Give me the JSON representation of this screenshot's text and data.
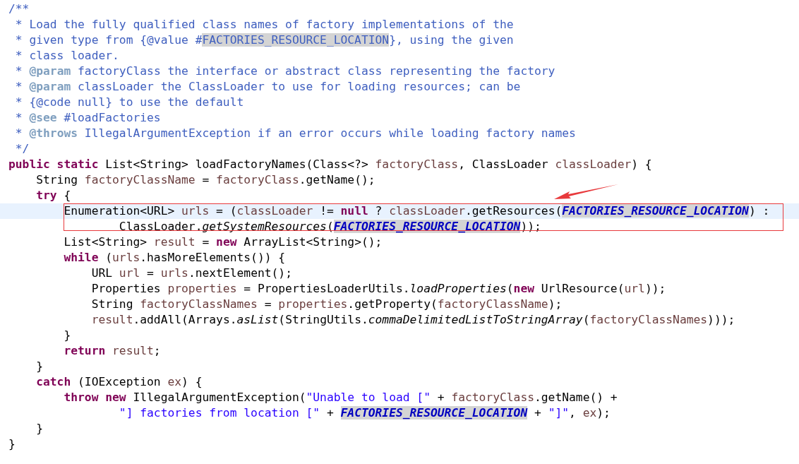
{
  "editor": {
    "lines": [
      {
        "current": false,
        "tokens": [
          {
            "text": "/**",
            "kind": "comment",
            "marked": false
          }
        ]
      },
      {
        "current": false,
        "tokens": [
          {
            "text": " * Load the fully qualified class names of factory implementations of the",
            "kind": "comment",
            "marked": false
          }
        ]
      },
      {
        "current": false,
        "tokens": [
          {
            "text": " * given type from {@value #",
            "kind": "comment",
            "marked": false
          },
          {
            "text": "FACTORIES_RESOURCE_LOCATION",
            "kind": "comment",
            "marked": true
          },
          {
            "text": "}, using the given",
            "kind": "comment",
            "marked": false
          }
        ]
      },
      {
        "current": false,
        "tokens": [
          {
            "text": " * class loader.",
            "kind": "comment",
            "marked": false
          }
        ]
      },
      {
        "current": false,
        "tokens": [
          {
            "text": " * ",
            "kind": "comment",
            "marked": false
          },
          {
            "text": "@param",
            "kind": "tag",
            "marked": false
          },
          {
            "text": " factoryClass the interface or abstract class representing the factory",
            "kind": "comment",
            "marked": false
          }
        ]
      },
      {
        "current": false,
        "tokens": [
          {
            "text": " * ",
            "kind": "comment",
            "marked": false
          },
          {
            "text": "@param",
            "kind": "tag",
            "marked": false
          },
          {
            "text": " classLoader the ClassLoader to use for loading resources; can be",
            "kind": "comment",
            "marked": false
          }
        ]
      },
      {
        "current": false,
        "tokens": [
          {
            "text": " * {@code null} to use the default",
            "kind": "comment",
            "marked": false
          }
        ]
      },
      {
        "current": false,
        "tokens": [
          {
            "text": " * ",
            "kind": "comment",
            "marked": false
          },
          {
            "text": "@see",
            "kind": "tag",
            "marked": false
          },
          {
            "text": " #loadFactories",
            "kind": "comment",
            "marked": false
          }
        ]
      },
      {
        "current": false,
        "tokens": [
          {
            "text": " * ",
            "kind": "comment",
            "marked": false
          },
          {
            "text": "@throws",
            "kind": "tag",
            "marked": false
          },
          {
            "text": " IllegalArgumentException if an error occurs while loading factory names",
            "kind": "comment",
            "marked": false
          }
        ]
      },
      {
        "current": false,
        "tokens": [
          {
            "text": " */",
            "kind": "comment",
            "marked": false
          }
        ]
      },
      {
        "current": false,
        "tokens": [
          {
            "text": "public static",
            "kind": "keyword",
            "marked": false
          },
          {
            "text": " List<String> loadFactoryNames(Class<?> ",
            "kind": "plain",
            "marked": false
          },
          {
            "text": "factoryClass",
            "kind": "variable",
            "marked": false
          },
          {
            "text": ", ClassLoader ",
            "kind": "plain",
            "marked": false
          },
          {
            "text": "classLoader",
            "kind": "variable",
            "marked": false
          },
          {
            "text": ") {",
            "kind": "plain",
            "marked": false
          }
        ]
      },
      {
        "current": false,
        "tokens": [
          {
            "text": "    String ",
            "kind": "plain",
            "marked": false
          },
          {
            "text": "factoryClassName",
            "kind": "variable",
            "marked": false
          },
          {
            "text": " = ",
            "kind": "plain",
            "marked": false
          },
          {
            "text": "factoryClass",
            "kind": "variable",
            "marked": false
          },
          {
            "text": ".getName();",
            "kind": "plain",
            "marked": false
          }
        ]
      },
      {
        "current": false,
        "tokens": [
          {
            "text": "    try",
            "kind": "keyword",
            "marked": false
          },
          {
            "text": " {",
            "kind": "plain",
            "marked": false
          }
        ]
      },
      {
        "current": true,
        "tokens": [
          {
            "text": "        Enumeration<URL> ",
            "kind": "plain",
            "marked": false
          },
          {
            "text": "urls",
            "kind": "variable",
            "marked": false
          },
          {
            "text": " = (",
            "kind": "plain",
            "marked": false
          },
          {
            "text": "classLoader",
            "kind": "variable",
            "marked": false
          },
          {
            "text": " != ",
            "kind": "plain",
            "marked": false
          },
          {
            "text": "null",
            "kind": "keyword",
            "marked": false
          },
          {
            "text": " ? ",
            "kind": "plain",
            "marked": false
          },
          {
            "text": "classLoader",
            "kind": "variable",
            "marked": false
          },
          {
            "text": ".getResources(",
            "kind": "plain",
            "marked": false
          },
          {
            "text": "FACTORIES_RESOURCE_LOCATION",
            "kind": "field",
            "marked": true
          },
          {
            "text": ") :",
            "kind": "plain",
            "marked": false
          }
        ]
      },
      {
        "current": false,
        "tokens": [
          {
            "text": "                ClassLoader.",
            "kind": "plain",
            "marked": false
          },
          {
            "text": "getSystemResources",
            "kind": "static",
            "marked": false
          },
          {
            "text": "(",
            "kind": "plain",
            "marked": false
          },
          {
            "text": "FACTORIES_RESOURCE_LOCATION",
            "kind": "field",
            "marked": true
          },
          {
            "text": "));",
            "kind": "plain",
            "marked": false
          }
        ]
      },
      {
        "current": false,
        "tokens": [
          {
            "text": "        List<String> ",
            "kind": "plain",
            "marked": false
          },
          {
            "text": "result",
            "kind": "variable",
            "marked": false
          },
          {
            "text": " = ",
            "kind": "plain",
            "marked": false
          },
          {
            "text": "new",
            "kind": "keyword",
            "marked": false
          },
          {
            "text": " ArrayList<String>();",
            "kind": "plain",
            "marked": false
          }
        ]
      },
      {
        "current": false,
        "tokens": [
          {
            "text": "        while",
            "kind": "keyword",
            "marked": false
          },
          {
            "text": " (",
            "kind": "plain",
            "marked": false
          },
          {
            "text": "urls",
            "kind": "variable",
            "marked": false
          },
          {
            "text": ".hasMoreElements()) {",
            "kind": "plain",
            "marked": false
          }
        ]
      },
      {
        "current": false,
        "tokens": [
          {
            "text": "            URL ",
            "kind": "plain",
            "marked": false
          },
          {
            "text": "url",
            "kind": "variable",
            "marked": false
          },
          {
            "text": " = ",
            "kind": "plain",
            "marked": false
          },
          {
            "text": "urls",
            "kind": "variable",
            "marked": false
          },
          {
            "text": ".nextElement();",
            "kind": "plain",
            "marked": false
          }
        ]
      },
      {
        "current": false,
        "tokens": [
          {
            "text": "            Properties ",
            "kind": "plain",
            "marked": false
          },
          {
            "text": "properties",
            "kind": "variable",
            "marked": false
          },
          {
            "text": " = PropertiesLoaderUtils.",
            "kind": "plain",
            "marked": false
          },
          {
            "text": "loadProperties",
            "kind": "static",
            "marked": false
          },
          {
            "text": "(",
            "kind": "plain",
            "marked": false
          },
          {
            "text": "new",
            "kind": "keyword",
            "marked": false
          },
          {
            "text": " UrlResource(",
            "kind": "plain",
            "marked": false
          },
          {
            "text": "url",
            "kind": "variable",
            "marked": false
          },
          {
            "text": "));",
            "kind": "plain",
            "marked": false
          }
        ]
      },
      {
        "current": false,
        "tokens": [
          {
            "text": "            String ",
            "kind": "plain",
            "marked": false
          },
          {
            "text": "factoryClassNames",
            "kind": "variable",
            "marked": false
          },
          {
            "text": " = ",
            "kind": "plain",
            "marked": false
          },
          {
            "text": "properties",
            "kind": "variable",
            "marked": false
          },
          {
            "text": ".getProperty(",
            "kind": "plain",
            "marked": false
          },
          {
            "text": "factoryClassName",
            "kind": "variable",
            "marked": false
          },
          {
            "text": ");",
            "kind": "plain",
            "marked": false
          }
        ]
      },
      {
        "current": false,
        "tokens": [
          {
            "text": "            result",
            "kind": "variable",
            "marked": false
          },
          {
            "text": ".addAll(Arrays.",
            "kind": "plain",
            "marked": false
          },
          {
            "text": "asList",
            "kind": "static",
            "marked": false
          },
          {
            "text": "(StringUtils.",
            "kind": "plain",
            "marked": false
          },
          {
            "text": "commaDelimitedListToStringArray",
            "kind": "static",
            "marked": false
          },
          {
            "text": "(",
            "kind": "plain",
            "marked": false
          },
          {
            "text": "factoryClassNames",
            "kind": "variable",
            "marked": false
          },
          {
            "text": ")));",
            "kind": "plain",
            "marked": false
          }
        ]
      },
      {
        "current": false,
        "tokens": [
          {
            "text": "        }",
            "kind": "plain",
            "marked": false
          }
        ]
      },
      {
        "current": false,
        "tokens": [
          {
            "text": "        return",
            "kind": "keyword",
            "marked": false
          },
          {
            "text": " result",
            "kind": "variable",
            "marked": false
          },
          {
            "text": ";",
            "kind": "plain",
            "marked": false
          }
        ]
      },
      {
        "current": false,
        "tokens": [
          {
            "text": "    }",
            "kind": "plain",
            "marked": false
          }
        ]
      },
      {
        "current": false,
        "tokens": [
          {
            "text": "    catch",
            "kind": "keyword",
            "marked": false
          },
          {
            "text": " (IOException ",
            "kind": "plain",
            "marked": false
          },
          {
            "text": "ex",
            "kind": "variable",
            "marked": false
          },
          {
            "text": ") {",
            "kind": "plain",
            "marked": false
          }
        ]
      },
      {
        "current": false,
        "tokens": [
          {
            "text": "        throw new",
            "kind": "keyword",
            "marked": false
          },
          {
            "text": " IllegalArgumentException(",
            "kind": "plain",
            "marked": false
          },
          {
            "text": "\"Unable to load [\"",
            "kind": "string",
            "marked": false
          },
          {
            "text": " + ",
            "kind": "plain",
            "marked": false
          },
          {
            "text": "factoryClass",
            "kind": "variable",
            "marked": false
          },
          {
            "text": ".getName() +",
            "kind": "plain",
            "marked": false
          }
        ]
      },
      {
        "current": false,
        "tokens": [
          {
            "text": "                \"] factories from location [\"",
            "kind": "string",
            "marked": false
          },
          {
            "text": " + ",
            "kind": "plain",
            "marked": false
          },
          {
            "text": "FACTORIES_RESOURCE_LOCATION",
            "kind": "field",
            "marked": true
          },
          {
            "text": " + ",
            "kind": "plain",
            "marked": false
          },
          {
            "text": "\"]\"",
            "kind": "string",
            "marked": false
          },
          {
            "text": ", ",
            "kind": "plain",
            "marked": false
          },
          {
            "text": "ex",
            "kind": "variable",
            "marked": false
          },
          {
            "text": ");",
            "kind": "plain",
            "marked": false
          }
        ]
      },
      {
        "current": false,
        "tokens": [
          {
            "text": "    }",
            "kind": "plain",
            "marked": false
          }
        ]
      },
      {
        "current": false,
        "tokens": [
          {
            "text": "}",
            "kind": "plain",
            "marked": false
          }
        ]
      }
    ]
  }
}
